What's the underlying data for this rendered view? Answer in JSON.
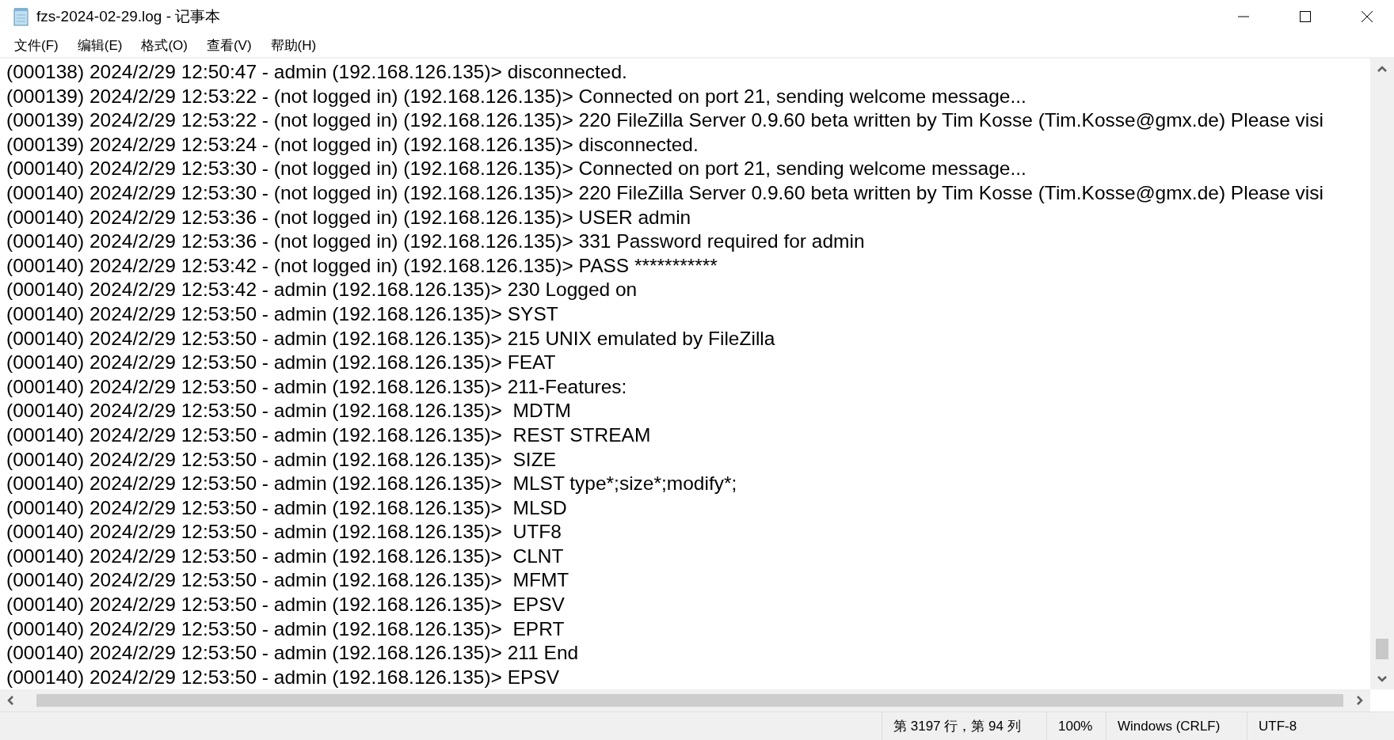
{
  "window": {
    "title": "fzs-2024-02-29.log - 记事本"
  },
  "menu": [
    {
      "label": "文件(F)"
    },
    {
      "label": "编辑(E)"
    },
    {
      "label": "格式(O)"
    },
    {
      "label": "查看(V)"
    },
    {
      "label": "帮助(H)"
    }
  ],
  "lines": [
    "(000138) 2024/2/29 12:50:47 - admin (192.168.126.135)> disconnected.",
    "(000139) 2024/2/29 12:53:22 - (not logged in) (192.168.126.135)> Connected on port 21, sending welcome message...",
    "(000139) 2024/2/29 12:53:22 - (not logged in) (192.168.126.135)> 220 FileZilla Server 0.9.60 beta written by Tim Kosse (Tim.Kosse@gmx.de) Please visi",
    "(000139) 2024/2/29 12:53:24 - (not logged in) (192.168.126.135)> disconnected.",
    "(000140) 2024/2/29 12:53:30 - (not logged in) (192.168.126.135)> Connected on port 21, sending welcome message...",
    "(000140) 2024/2/29 12:53:30 - (not logged in) (192.168.126.135)> 220 FileZilla Server 0.9.60 beta written by Tim Kosse (Tim.Kosse@gmx.de) Please visi",
    "(000140) 2024/2/29 12:53:36 - (not logged in) (192.168.126.135)> USER admin",
    "(000140) 2024/2/29 12:53:36 - (not logged in) (192.168.126.135)> 331 Password required for admin",
    "(000140) 2024/2/29 12:53:42 - (not logged in) (192.168.126.135)> PASS ***********",
    "(000140) 2024/2/29 12:53:42 - admin (192.168.126.135)> 230 Logged on",
    "(000140) 2024/2/29 12:53:50 - admin (192.168.126.135)> SYST",
    "(000140) 2024/2/29 12:53:50 - admin (192.168.126.135)> 215 UNIX emulated by FileZilla",
    "(000140) 2024/2/29 12:53:50 - admin (192.168.126.135)> FEAT",
    "(000140) 2024/2/29 12:53:50 - admin (192.168.126.135)> 211-Features:",
    "(000140) 2024/2/29 12:53:50 - admin (192.168.126.135)>  MDTM",
    "(000140) 2024/2/29 12:53:50 - admin (192.168.126.135)>  REST STREAM",
    "(000140) 2024/2/29 12:53:50 - admin (192.168.126.135)>  SIZE",
    "(000140) 2024/2/29 12:53:50 - admin (192.168.126.135)>  MLST type*;size*;modify*;",
    "(000140) 2024/2/29 12:53:50 - admin (192.168.126.135)>  MLSD",
    "(000140) 2024/2/29 12:53:50 - admin (192.168.126.135)>  UTF8",
    "(000140) 2024/2/29 12:53:50 - admin (192.168.126.135)>  CLNT",
    "(000140) 2024/2/29 12:53:50 - admin (192.168.126.135)>  MFMT",
    "(000140) 2024/2/29 12:53:50 - admin (192.168.126.135)>  EPSV",
    "(000140) 2024/2/29 12:53:50 - admin (192.168.126.135)>  EPRT",
    "(000140) 2024/2/29 12:53:50 - admin (192.168.126.135)> 211 End",
    "(000140) 2024/2/29 12:53:50 - admin (192.168.126.135)> EPSV"
  ],
  "status_bar": [
    "第 3197 行，第 94 列",
    "100%",
    "Windows (CRLF)",
    "UTF-8"
  ]
}
